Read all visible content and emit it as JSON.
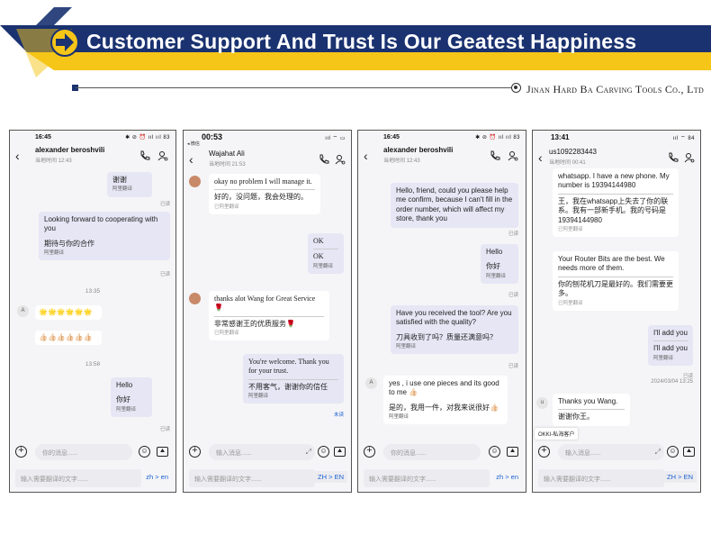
{
  "banner": {
    "title": "Customer Support And Trust Is Our Geatest Happiness",
    "company": "Jinan Hard Ba Carving Tools Co., Ltd",
    "colors": {
      "navy": "#1a3270",
      "yellow": "#f5c518"
    }
  },
  "icons": {
    "arrow": "arrow-right-icon",
    "call": "phone-call-icon",
    "profile": "user-settings-icon"
  },
  "phones": [
    {
      "status_time": "16:45",
      "status_icons": "✱ ⊘ ⏰ ııl ııl 83",
      "contact": "alexander beroshvili",
      "contact_sub": "当地时间 12:43",
      "messages": {
        "m1": "谢谢",
        "m1_tr": "阿里翻译",
        "m1_read": "已读",
        "m2": "Looking forward to cooperating with you",
        "m2_b": "期待与你的合作",
        "m2_tr": "阿里翻译",
        "m2_read": "已读",
        "ts1": "13:35",
        "avatar": "A",
        "emoji1": "🌟🌟🌟🌟🌟🌟",
        "emoji2": "👍🏻👍🏻👍🏻👍🏻👍🏻👍🏻",
        "ts2": "13:58",
        "m3": "Hello",
        "m3_b": "你好",
        "m3_tr": "阿里翻译",
        "m3_read": "已读"
      },
      "input_placeholder": "你的消息......",
      "trans_placeholder": "输入需要翻译的文字......",
      "lang": "zh > en"
    },
    {
      "status_time": "00:53",
      "status_sub": "◂ 微信",
      "status_icons": "ııl ⌔ ▭",
      "contact": "Wajahat Ali",
      "contact_sub": "当地时间 21:53",
      "messages": {
        "m1": "okay no problem I will manage it.",
        "m1_b": "好的，没问题，我会处理的。",
        "m1_tr": "已阿里翻译",
        "m2": "OK",
        "m2_b": "OK",
        "m2_tr": "阿里翻译",
        "m3": "thanks alot Wang for Great Service 🌹",
        "m3_b": "非常感谢王的优质服务🌹",
        "m3_tr": "已阿里翻译",
        "m4": "You're welcome. Thank you for your trust.",
        "m4_b": "不用客气，谢谢你的信任",
        "m4_tr": "阿里翻译",
        "m4_read": "未读"
      },
      "input_placeholder": "输入消息......",
      "trans_placeholder": "输入需要翻译的文字......",
      "lang": "ZH > EN"
    },
    {
      "status_time": "16:45",
      "status_icons": "✱ ⊘ ⏰ ııl ııl 83",
      "contact": "alexander beroshvili",
      "contact_sub": "当地时间 12:43",
      "messages": {
        "m1": "Hello, friend, could you please help me confirm, because I can't fill in the order number, which will affect my store, thank you",
        "m1_read": "已读",
        "m2": "Hello",
        "m2_b": "你好",
        "m2_tr": "阿里翻译",
        "m2_read": "已读",
        "m3": "Have you received the tool? Are you satisfied with the quality?",
        "m3_b": "刀具收到了吗？质量还满意吗？",
        "m3_tr": "阿里翻译",
        "m3_read": "已读",
        "avatar": "A",
        "m4": "yes , i use one pieces and its good to me 👍🏻",
        "m4_b": "是的，我用一件，对我来说很好👍🏻",
        "m4_tr": "阿里翻译"
      },
      "input_placeholder": "你的消息......",
      "trans_placeholder": "输入需要翻译的文字......",
      "lang": "zh > en"
    },
    {
      "status_time": "13:41",
      "status_icons": "ııl ⌔ 84",
      "contact": "us1092283443",
      "contact_sub": "当地时间 00:41",
      "messages": {
        "m1": "whatsapp. I have a new phone. My number is 19394144980",
        "m1_b": "王，我在whatsapp上失去了你的联系。我有一部新手机。我的号码是19394144980",
        "m1_tr": "已阿里翻译",
        "m2": "Your Router Bits are the best. We needs more of them.",
        "m2_b": "你的刨花机刀是最好的。我们需要更多。",
        "m2_tr": "已阿里翻译",
        "m3": "I'll add you",
        "m3_b": "I'll add you",
        "m3_tr": "阿里翻译",
        "m3_read": "已读",
        "ts": "2024/03/04 13:25",
        "avatar": "u",
        "m4": "Thanks you Wang.",
        "m4_b": "谢谢你王。",
        "okki": "OKKI-私海客户"
      },
      "input_placeholder": "输入消息......",
      "trans_placeholder": "输入需要翻译的文字......",
      "lang": "ZH > EN"
    }
  ]
}
